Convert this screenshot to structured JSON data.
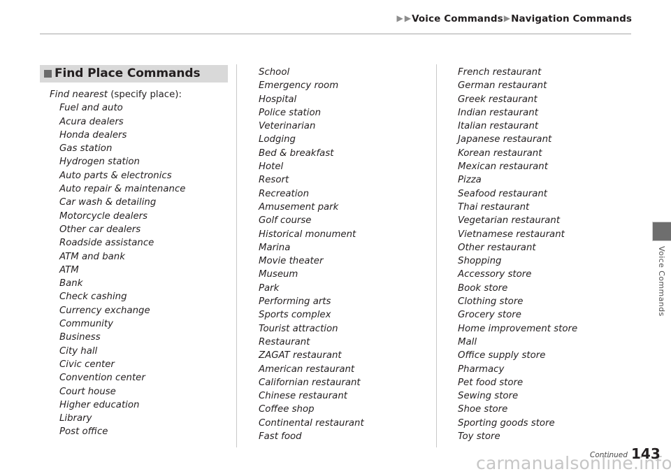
{
  "header": {
    "breadcrumb": {
      "arrow_icon": "triangle-right-icon",
      "crumb_1": "Voice Commands",
      "crumb_2": "Navigation Commands"
    }
  },
  "side_tab": {
    "label": "Voice Commands"
  },
  "section": {
    "bullet_icon": "square-bullet-icon",
    "title": "Find Place Commands",
    "intro_emphasis": "Find nearest",
    "intro_plain": " (specify place):"
  },
  "columns": [
    {
      "name": "column-1",
      "items": [
        "Fuel and auto",
        "Acura dealers",
        "Honda dealers",
        "Gas station",
        "Hydrogen station",
        "Auto parts & electronics",
        "Auto repair & maintenance",
        "Car wash & detailing",
        "Motorcycle dealers",
        "Other car dealers",
        "Roadside assistance",
        "ATM and bank",
        "ATM",
        "Bank",
        "Check cashing",
        "Currency exchange",
        "Community",
        "Business",
        "City hall",
        "Civic center",
        "Convention center",
        "Court house",
        "Higher education",
        "Library",
        "Post office"
      ]
    },
    {
      "name": "column-2",
      "items": [
        "School",
        "Emergency room",
        "Hospital",
        "Police station",
        "Veterinarian",
        "Lodging",
        "Bed & breakfast",
        "Hotel",
        "Resort",
        "Recreation",
        "Amusement park",
        "Golf course",
        "Historical monument",
        "Marina",
        "Movie theater",
        "Museum",
        "Park",
        "Performing arts",
        "Sports complex",
        "Tourist attraction",
        "Restaurant",
        "ZAGAT restaurant",
        "American restaurant",
        "Californian restaurant",
        "Chinese restaurant",
        "Coffee shop",
        "Continental restaurant",
        "Fast food"
      ]
    },
    {
      "name": "column-3",
      "items": [
        "French restaurant",
        "German restaurant",
        "Greek restaurant",
        "Indian restaurant",
        "Italian restaurant",
        "Japanese restaurant",
        "Korean restaurant",
        "Mexican restaurant",
        "Pizza",
        "Seafood restaurant",
        "Thai restaurant",
        "Vegetarian restaurant",
        "Vietnamese restaurant",
        "Other restaurant",
        "Shopping",
        "Accessory store",
        "Book store",
        "Clothing store",
        "Grocery store",
        "Home improvement store",
        "Mall",
        "Office supply store",
        "Pharmacy",
        "Pet food store",
        "Sewing store",
        "Shoe store",
        "Sporting goods store",
        "Toy store"
      ]
    }
  ],
  "footer": {
    "continued": "Continued",
    "page_number": "143",
    "watermark": "carmanualsonline.info"
  },
  "colors": {
    "section_bar_bg": "#d9d9d9",
    "section_bullet": "#6b6b6b",
    "side_tab_bg": "#6e6e6e",
    "divider": "#c9c9c9",
    "rule": "#a7a7a7",
    "text": "#231f20",
    "watermark": "#c6c6c6"
  }
}
